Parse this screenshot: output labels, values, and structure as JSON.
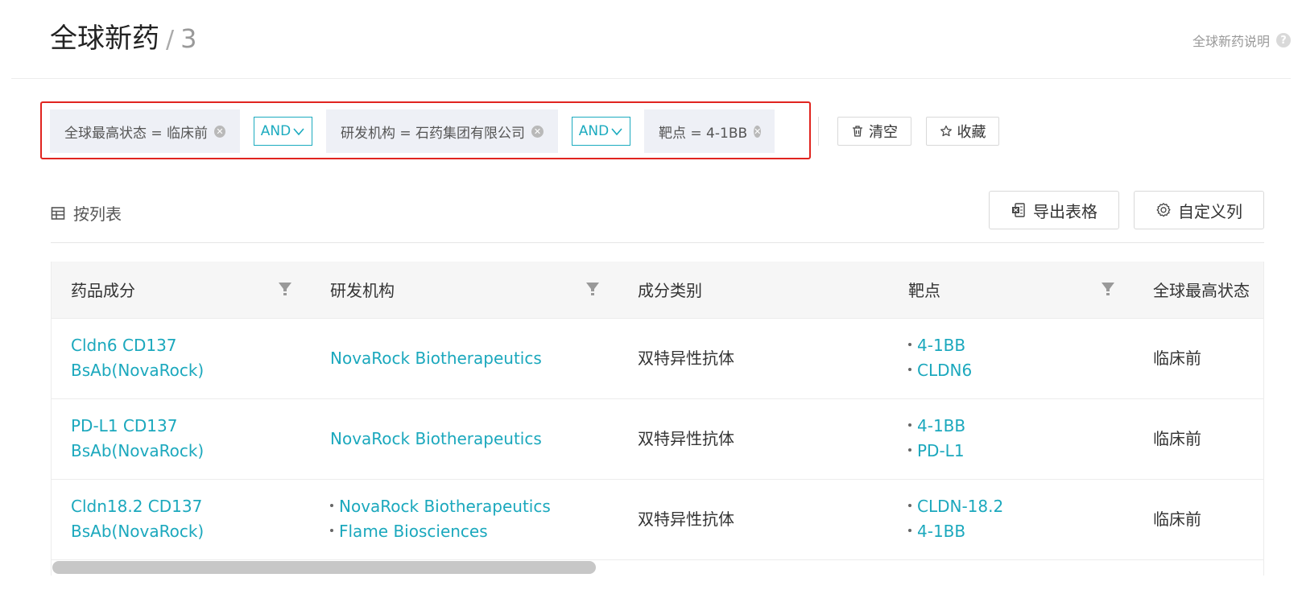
{
  "header": {
    "title": "全球新药",
    "separator": "/",
    "count": "3",
    "help_label": "全球新药说明",
    "help_icon": "?"
  },
  "filters": {
    "chips": [
      {
        "label": "全球最高状态 = 临床前"
      },
      {
        "label": "研发机构 = 石药集团有限公司"
      },
      {
        "label": "靶点 = 4-1BB"
      }
    ],
    "connectors": [
      "AND",
      "AND"
    ],
    "clear_label": "清空",
    "save_label": "收藏"
  },
  "view": {
    "label": "按列表",
    "export_label": "导出表格",
    "custom_columns_label": "自定义列"
  },
  "table": {
    "columns": [
      "药品成分",
      "研发机构",
      "成分类别",
      "靶点",
      "全球最高状态"
    ],
    "rows": [
      {
        "drug": "Cldn6 CD137 BsAb(NovaRock)",
        "orgs": [
          "NovaRock Biotherapeutics"
        ],
        "category": "双特异性抗体",
        "targets": [
          "4-1BB",
          "CLDN6"
        ],
        "status": "临床前"
      },
      {
        "drug": "PD-L1 CD137 BsAb(NovaRock)",
        "orgs": [
          "NovaRock Biotherapeutics"
        ],
        "category": "双特异性抗体",
        "targets": [
          "4-1BB",
          "PD-L1"
        ],
        "status": "临床前"
      },
      {
        "drug": "Cldn18.2 CD137 BsAb(NovaRock)",
        "orgs": [
          "NovaRock Biotherapeutics",
          "Flame Biosciences"
        ],
        "category": "双特异性抗体",
        "targets": [
          "CLDN-18.2",
          "4-1BB"
        ],
        "status": "临床前"
      }
    ]
  },
  "colors": {
    "accent": "#1ba8bd",
    "highlight_border": "#e0241f",
    "chip_bg": "#eef0f6",
    "header_bg": "#f6f6f6"
  },
  "icons": {
    "help": "question-circle-icon",
    "chip_close": "close-circle-icon",
    "connector": "chevron-down-icon",
    "clear": "trash-icon",
    "save": "star-icon",
    "view": "table-icon",
    "export": "excel-export-icon",
    "custom": "gear-icon",
    "column_filter": "funnel-icon"
  }
}
